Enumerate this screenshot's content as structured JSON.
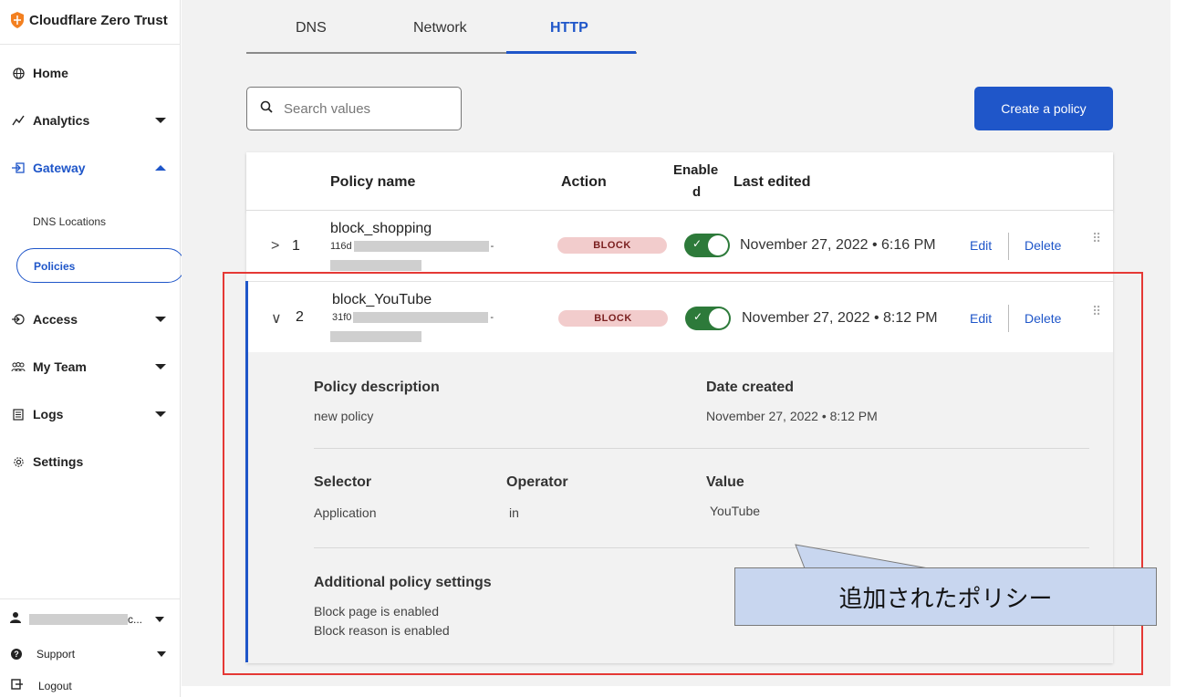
{
  "brand": {
    "name": "Cloudflare Zero Trust"
  },
  "sidebar": {
    "items": [
      {
        "label": "Home",
        "icon": "globe-icon"
      },
      {
        "label": "Analytics",
        "icon": "analytics-icon"
      },
      {
        "label": "Gateway",
        "icon": "gateway-icon",
        "active": true
      },
      {
        "label": "Access",
        "icon": "access-icon"
      },
      {
        "label": "My Team",
        "icon": "team-icon"
      },
      {
        "label": "Logs",
        "icon": "logs-icon"
      },
      {
        "label": "Settings",
        "icon": "gear-icon"
      }
    ],
    "sub_items": [
      {
        "label": "DNS Locations"
      },
      {
        "label": "Policies",
        "active": true
      }
    ],
    "user_suffix": "c...",
    "support": "Support",
    "logout": "Logout"
  },
  "tabs": [
    {
      "label": "DNS"
    },
    {
      "label": "Network"
    },
    {
      "label": "HTTP",
      "active": true
    }
  ],
  "search": {
    "placeholder": "Search values"
  },
  "create_button": "Create a policy",
  "table": {
    "headers": {
      "name": "Policy name",
      "action": "Action",
      "enabled_1": "Enable",
      "enabled_2": "d",
      "last_edited": "Last edited"
    },
    "rows": [
      {
        "num": "1",
        "chevron": ">",
        "name": "block_shopping",
        "id_prefix": "116d",
        "id_suffix": "-",
        "action": "BLOCK",
        "enabled": true,
        "last_edited": "November 27, 2022 • 6:16 PM",
        "edit": "Edit",
        "delete": "Delete"
      },
      {
        "num": "2",
        "chevron": "∨",
        "name": "block_YouTube",
        "id_prefix": "31f0",
        "id_suffix": "-",
        "action": "BLOCK",
        "enabled": true,
        "last_edited": "November 27, 2022 • 8:12 PM",
        "edit": "Edit",
        "delete": "Delete"
      }
    ]
  },
  "details": {
    "policy_description_label": "Policy description",
    "policy_description": "new policy",
    "date_created_label": "Date created",
    "date_created": "November 27, 2022 • 8:12 PM",
    "selector_label": "Selector",
    "selector": "Application",
    "operator_label": "Operator",
    "operator": "in",
    "value_label": "Value",
    "value": "YouTube",
    "additional_label": "Additional policy settings",
    "additional_1": "Block page is enabled",
    "additional_2": "Block reason is enabled"
  },
  "callout": {
    "text": "追加されたポリシー"
  },
  "colors": {
    "accent": "#1f56c9",
    "block_badge": "#f2cccc",
    "toggle_on": "#2d7a3a",
    "highlight_box": "#e53935",
    "callout_fill": "#c8d6ef"
  }
}
